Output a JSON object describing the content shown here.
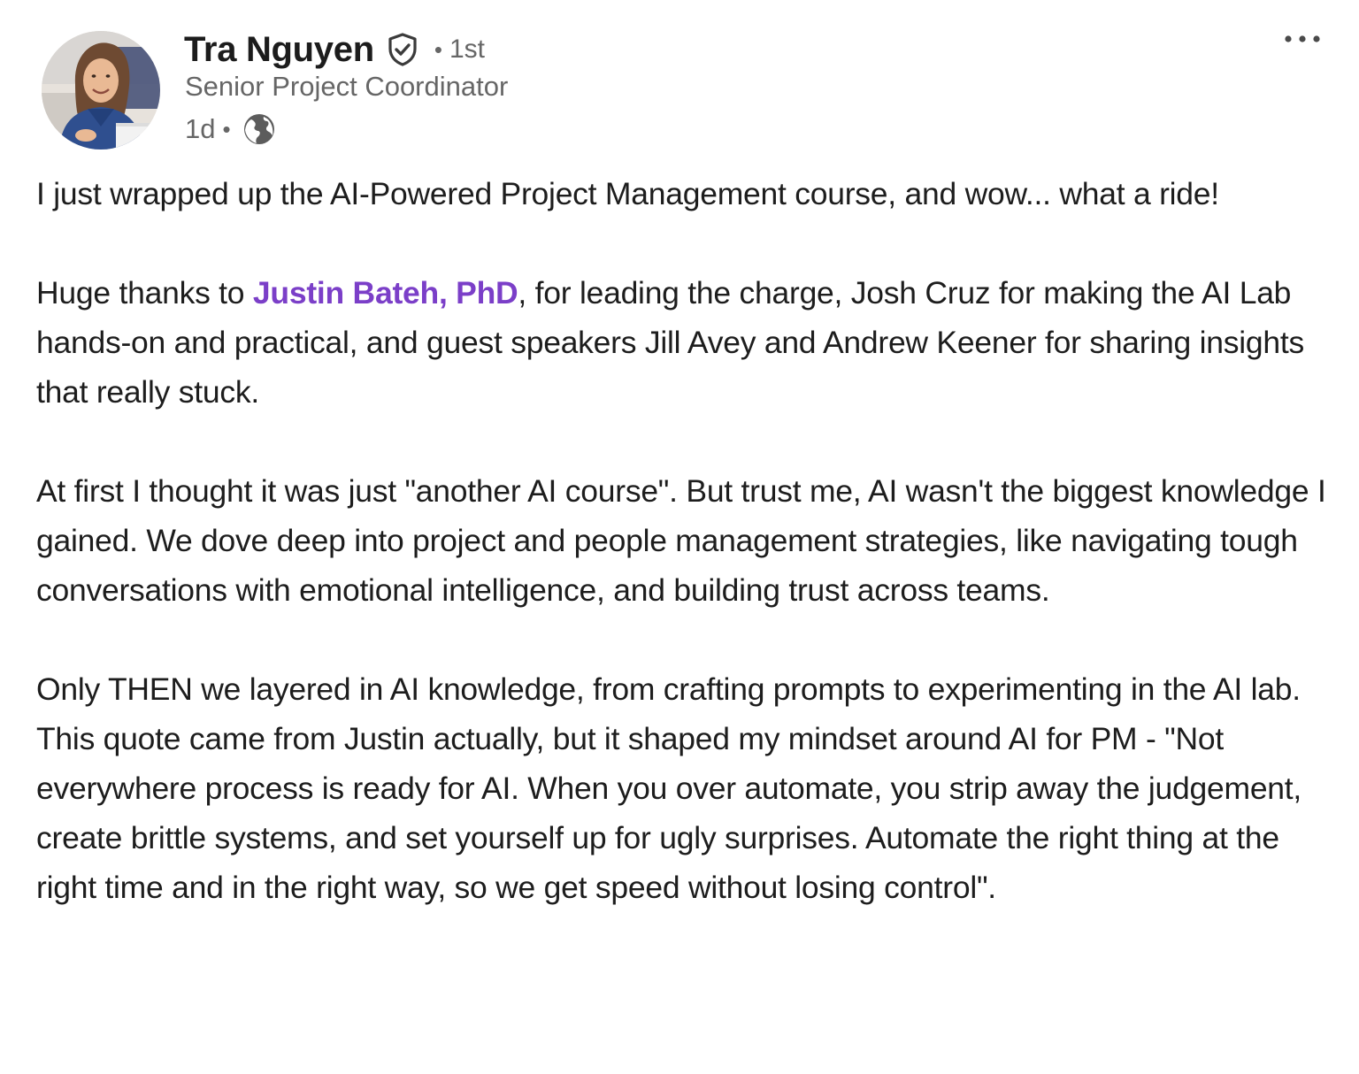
{
  "post": {
    "author": {
      "name": "Tra Nguyen",
      "degree_separator": "•",
      "degree": "1st",
      "headline": "Senior Project Coordinator",
      "time_ago": "1d",
      "meta_separator": "•",
      "verified_icon": "verified-shield-icon",
      "visibility_icon": "globe-icon"
    },
    "more_icon": "ellipsis-icon",
    "body": {
      "p1": "I just wrapped up the AI-Powered Project Management course, and wow... what a ride!",
      "p2_before": "Huge thanks to ",
      "p2_mention": "Justin Bateh, PhD",
      "p2_after": ", for leading the charge, Josh Cruz for making the AI Lab hands-on and practical, and guest speakers Jill Avey and Andrew Keener for sharing insights that really stuck.",
      "p3": "At first I thought it was just \"another AI course\". But trust me, AI wasn't the biggest knowledge I gained. We dove deep into project and people management strategies, like navigating tough conversations with emotional intelligence, and building trust across teams.",
      "p4": "Only THEN we layered in AI knowledge, from crafting prompts to experimenting in the AI lab. This quote came from Justin actually, but it shaped my mindset around AI for PM - \"Not everywhere process is ready for AI. When you over automate, you strip away the judgement, create brittle systems, and set yourself up for ugly surprises. Automate the right thing at the right time and in the right way, so we get speed without losing control\"."
    },
    "colors": {
      "mention": "#7b3fc8",
      "text": "#1d1d1d",
      "secondary_text": "#666666"
    }
  }
}
